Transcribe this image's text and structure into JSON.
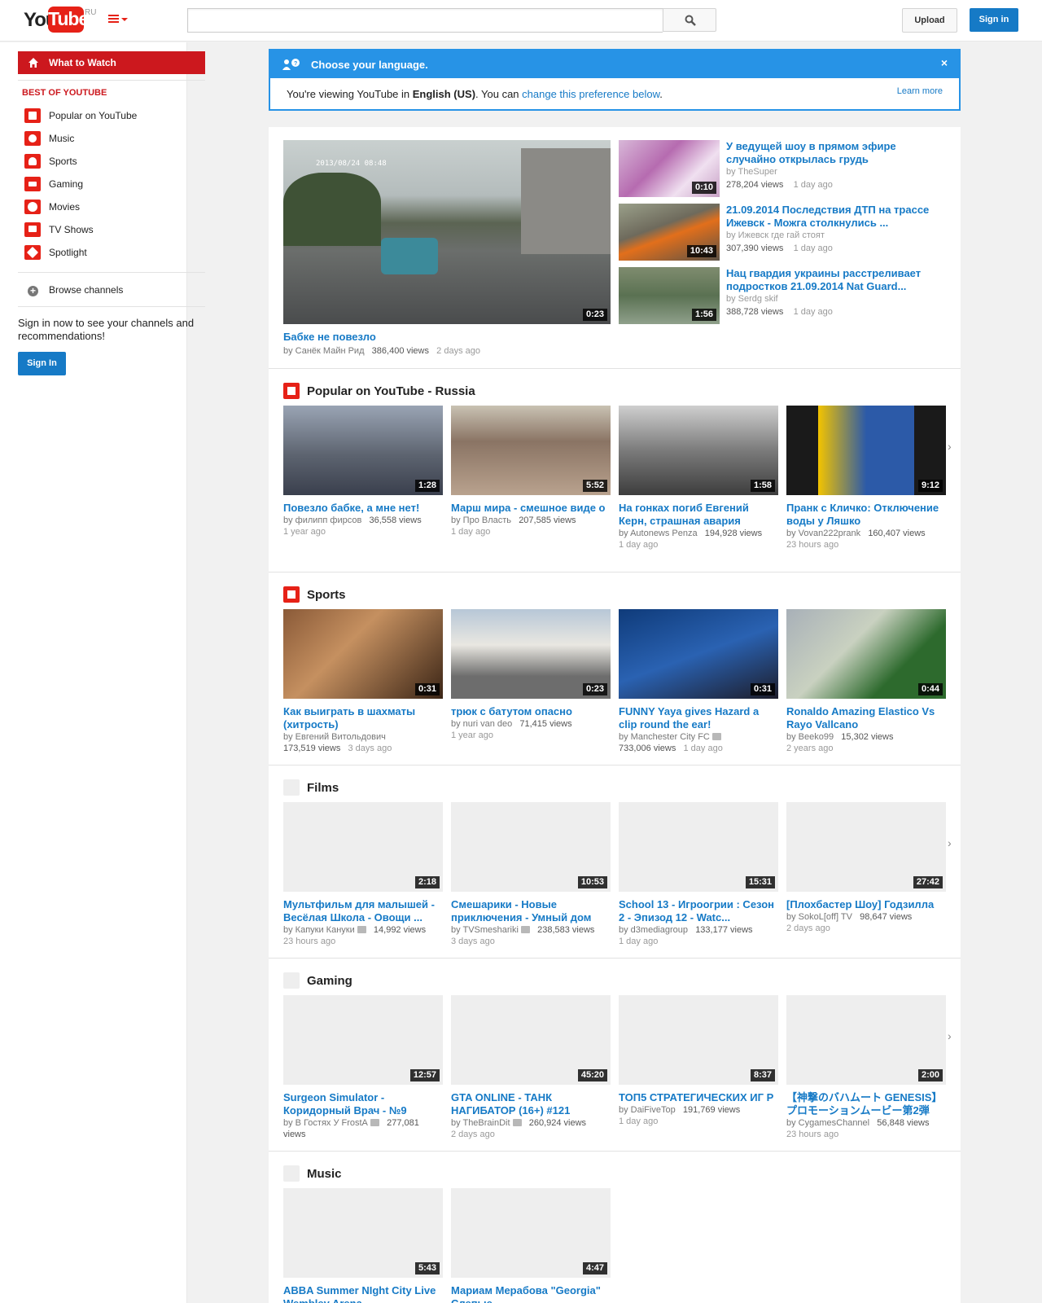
{
  "header": {
    "logo_you": "You",
    "logo_tube": "Tube",
    "country_code": "RU",
    "upload_label": "Upload",
    "signin_label": "Sign in"
  },
  "guide": {
    "active_item": "What to Watch",
    "section_head": "BEST OF YOUTUBE",
    "items": [
      {
        "label": "Popular on YouTube",
        "icon": "popular-icon"
      },
      {
        "label": "Music",
        "icon": "music-icon"
      },
      {
        "label": "Sports",
        "icon": "sports-icon"
      },
      {
        "label": "Gaming",
        "icon": "gaming-icon"
      },
      {
        "label": "Movies",
        "icon": "movies-icon"
      },
      {
        "label": "TV Shows",
        "icon": "tv-shows-icon"
      },
      {
        "label": "Spotlight",
        "icon": "spotlight-icon"
      }
    ],
    "browse_channels": "Browse channels",
    "signin_promo": "Sign in now to see your channels and recommendations!",
    "signin_button": "Sign In"
  },
  "language_notice": {
    "title": "Choose your language.",
    "close": "×",
    "msg_prefix": "You're viewing YouTube in ",
    "language": "English (US)",
    "msg_middle": ". You can ",
    "link": "change this preference below",
    "msg_suffix": ".",
    "learn_more": "Learn more"
  },
  "featured": {
    "main": {
      "title": "Бабке не повезло",
      "by": "by Санёк Майн Рид",
      "views": "386,400 views",
      "ago": "2 days ago",
      "duration": "0:23",
      "date_overlay": "2013/08/24 08:48"
    },
    "side": [
      {
        "title": "У ведущей шоу в прямом эфире случайно открылась грудь",
        "by": "by TheSuper",
        "views": "278,204 views",
        "ago": "1 day ago",
        "duration": "0:10"
      },
      {
        "title": "21.09.2014 Последствия ДТП на трассе Ижевск - Можга столкнулись ...",
        "by": "by Ижевск где гай стоят",
        "views": "307,390 views",
        "ago": "1 day ago",
        "duration": "10:43"
      },
      {
        "title": "Нац гвардия украины расстреливает подростков 21.09.2014 Nat Guard...",
        "by": "by Serdg skif",
        "views": "388,728 views",
        "ago": "1 day ago",
        "duration": "1:56"
      }
    ]
  },
  "shelves": [
    {
      "title": "Popular on YouTube - Russia",
      "icon": "popular-icon",
      "videos": [
        {
          "title": "Повезло бабке, а мне нет!",
          "by": "by филипп фирсов",
          "views": "36,558 views",
          "ago": "1 year ago",
          "duration": "1:28",
          "verified": false
        },
        {
          "title": "Марш мира - смешное виде о",
          "by": "by Про Власть",
          "views": "207,585 views",
          "ago": "1 day ago",
          "duration": "5:52",
          "verified": false
        },
        {
          "title": "На гонках погиб Евгений Керн, страшная авария",
          "by": "by Autonews Penza",
          "views": "194,928 views",
          "ago": "1 day ago",
          "duration": "1:58",
          "verified": false
        },
        {
          "title": "Пранк с Кличко: Отключение воды у Ляшко",
          "by": "by Vovan222prank",
          "views": "160,407 views",
          "ago": "23 hours ago",
          "duration": "9:12",
          "verified": false
        }
      ]
    },
    {
      "title": "Sports",
      "icon": "sports-icon",
      "videos": [
        {
          "title": "Как выиграть в шахматы (хитрость)",
          "by": "by Евгений Витольдович",
          "views": "173,519 views",
          "ago": "3 days ago",
          "duration": "0:31",
          "verified": false
        },
        {
          "title": "трюк с батутом опасно",
          "by": "by nuri van deo",
          "views": "71,415 views",
          "ago": "1 year ago",
          "duration": "0:23",
          "verified": false
        },
        {
          "title": "FUNNY Yaya gives Hazard a clip round the ear!",
          "by": "by Manchester City FC",
          "views": "733,006 views",
          "ago": "1 day ago",
          "duration": "0:31",
          "verified": true
        },
        {
          "title": "Ronaldo Amazing Elastico Vs Rayo Vallcano",
          "by": "by Beeko99",
          "views": "15,302 views",
          "ago": "2 years ago",
          "duration": "0:44",
          "verified": false
        }
      ]
    },
    {
      "title": "Films",
      "icon": "films-icon",
      "videos": [
        {
          "title": "Мультфильм для малышей - Весёлая Школа - Овощи ...",
          "by": "by Капуки Кануки",
          "views": "14,992 views",
          "ago": "23 hours ago",
          "duration": "2:18",
          "verified": true
        },
        {
          "title": "Смешарики - Новые приключения - Умный дом",
          "by": "by TVSmeshariki",
          "views": "238,583 views",
          "ago": "3 days ago",
          "duration": "10:53",
          "verified": true
        },
        {
          "title": "School 13 - Игроогрии : Сезон 2 - Эпизод 12 - Watc...",
          "by": "by d3mediagroup",
          "views": "133,177 views",
          "ago": "1 day ago",
          "duration": "15:31",
          "verified": false
        },
        {
          "title": "[Плохбастер Шоу] Годзилла",
          "by": "by SokoL[off] TV",
          "views": "98,647 views",
          "ago": "2 days ago",
          "duration": "27:42",
          "verified": false
        }
      ]
    },
    {
      "title": "Gaming",
      "icon": "gaming-icon",
      "videos": [
        {
          "title": "Surgeon Simulator - Коридорный Врач - №9",
          "by": "by В Гостях У FrostA",
          "views": "277,081 views",
          "ago": "2 days ago",
          "duration": "12:57",
          "verified": true
        },
        {
          "title": "GTA ONLINE - ТАНК НАГИБАТОР (16+) #121",
          "by": "by TheBrainDit",
          "views": "260,924 views",
          "ago": "2 days ago",
          "duration": "45:20",
          "verified": true
        },
        {
          "title": "ТОП5 СТРАТЕГИЧЕСКИХ ИГ Р",
          "by": "by DaiFiveTop",
          "views": "191,769 views",
          "ago": "1 day ago",
          "duration": "8:37",
          "verified": false
        },
        {
          "title": "【神撃のバハムート GENESIS】プロモーションムービー第2弾",
          "by": "by CygamesChannel",
          "views": "56,848 views",
          "ago": "23 hours ago",
          "duration": "2:00",
          "verified": false
        }
      ]
    },
    {
      "title": "Music",
      "icon": "music-icon",
      "videos": [
        {
          "title": "ABBA Summer NIght City Live Wembley Arena",
          "duration": "5:43"
        },
        {
          "title": "Мариам Мерабова \"Georgia\" Слепые",
          "duration": "4:47"
        }
      ]
    }
  ]
}
